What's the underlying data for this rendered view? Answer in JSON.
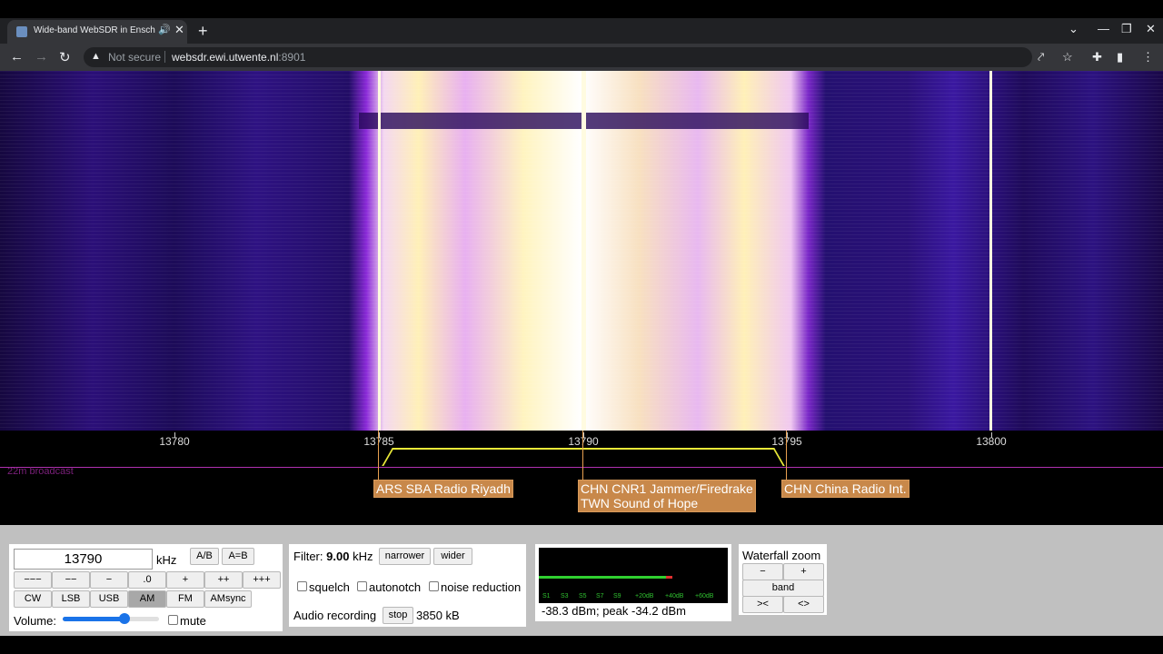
{
  "browser": {
    "tab_title": "Wide-band WebSDR in Ensch",
    "tab_audio_icon": "speaker-icon",
    "new_tab": "+",
    "security": "Not secure",
    "url_host": "websdr.ewi.utwente.nl",
    "url_port": ":8901"
  },
  "waterfall": {
    "freq_ticks": [
      "13780",
      "13785",
      "13790",
      "13795",
      "13800"
    ],
    "band_label": "22m broadcast",
    "stations": [
      {
        "line1": "ARS SBA Radio Riyadh",
        "line2": ""
      },
      {
        "line1": "CHN CNR1 Jammer/Firedrake",
        "line2": "TWN Sound of Hope"
      },
      {
        "line1": "CHN China Radio Int.",
        "line2": ""
      }
    ]
  },
  "tuning": {
    "frequency": "13790",
    "unit": "kHz",
    "ab": "A/B",
    "a_eq_b": "A=B",
    "steps": [
      "−−−",
      "−−",
      "−",
      ".0",
      "+",
      "++",
      "+++"
    ],
    "modes": [
      "CW",
      "LSB",
      "USB",
      "AM",
      "FM",
      "AMsync"
    ],
    "active_mode": "AM",
    "volume_label": "Volume:",
    "volume_level": 0.64,
    "mute_label": "mute",
    "mute_checked": false
  },
  "filter": {
    "label": "Filter:",
    "value": "9.00",
    "unit": "kHz",
    "narrower": "narrower",
    "wider": "wider",
    "squelch": "squelch",
    "autonotch": "autonotch",
    "noise_reduction": "noise reduction",
    "recording_label": "Audio recording",
    "stop": "stop",
    "recording_size": "3850 kB"
  },
  "smeter": {
    "scale": [
      "S1",
      "S3",
      "S5",
      "S7",
      "S9",
      "+20dB",
      "+40dB",
      "+60dB"
    ],
    "reading": "-38.3 dBm; peak  -34.2 dBm"
  },
  "zoom": {
    "title": "Waterfall zoom",
    "minus": "−",
    "plus": "+",
    "band": "band",
    "narrow": "><",
    "wide": "<>"
  },
  "colors": {
    "passband": "#e8e838",
    "station_label_bg": "#c8884a",
    "band_line": "#b030b0"
  }
}
